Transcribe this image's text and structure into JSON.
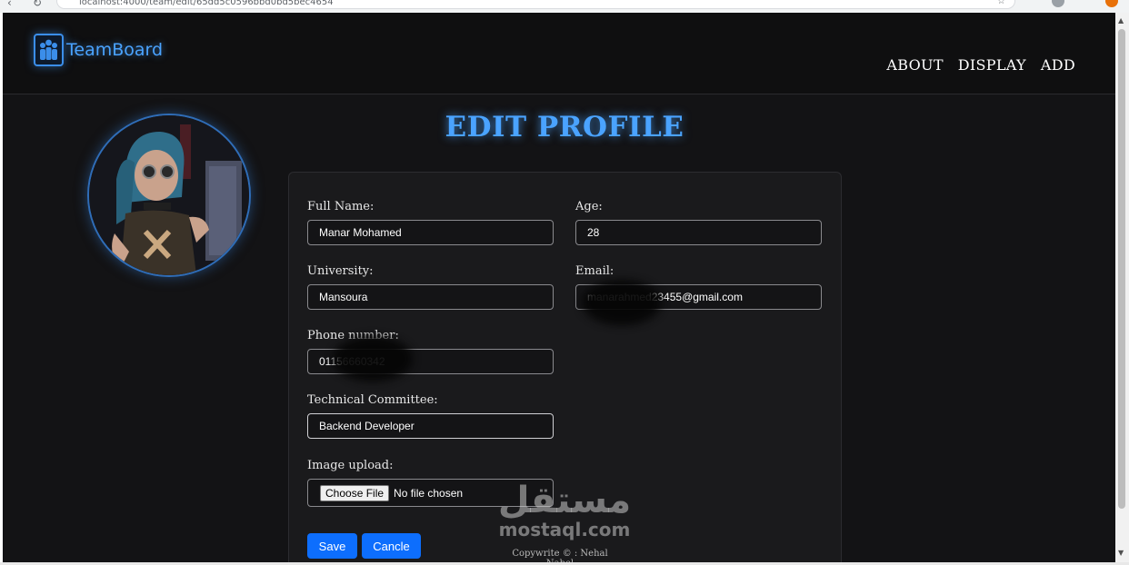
{
  "browser": {
    "url": "localhost:4000/team/edit/65dd5c0596bbd0bd5bec4654",
    "back_icon": "arrow-left-icon",
    "reload_icon": "reload-icon",
    "bookmark_icon": "star-icon"
  },
  "navbar": {
    "brand": "TeamBoard",
    "logo_icon": "team-logo-icon",
    "links": [
      "ABOUT",
      "DISPLAY",
      "ADD"
    ]
  },
  "page_title": "EDIT PROFILE",
  "form": {
    "full_name": {
      "label": "Full Name:",
      "value": "Manar Mohamed"
    },
    "age": {
      "label": "Age:",
      "value": "28"
    },
    "university": {
      "label": "University:",
      "value": "Mansoura"
    },
    "email": {
      "label": "Email:",
      "value": "manarahmed23455@gmail.com"
    },
    "phone": {
      "label": "Phone number:",
      "value": "01156660342"
    },
    "committee": {
      "label": "Technical Committee:",
      "value": "Backend Developer"
    },
    "image_upload": {
      "label": "Image upload:",
      "button": "Choose File",
      "status": "No file chosen"
    },
    "save_label": "Save",
    "cancel_label": "Cancle"
  },
  "footer": {
    "copyright": "Copywrite © : Nehal Nabel"
  },
  "watermark": {
    "arabic": "مستقل",
    "latin": "mostaql.com"
  },
  "colors": {
    "accent": "#4aa3ff",
    "button": "#0d6efd",
    "background": "#131315",
    "card": "#1a1a1c"
  }
}
